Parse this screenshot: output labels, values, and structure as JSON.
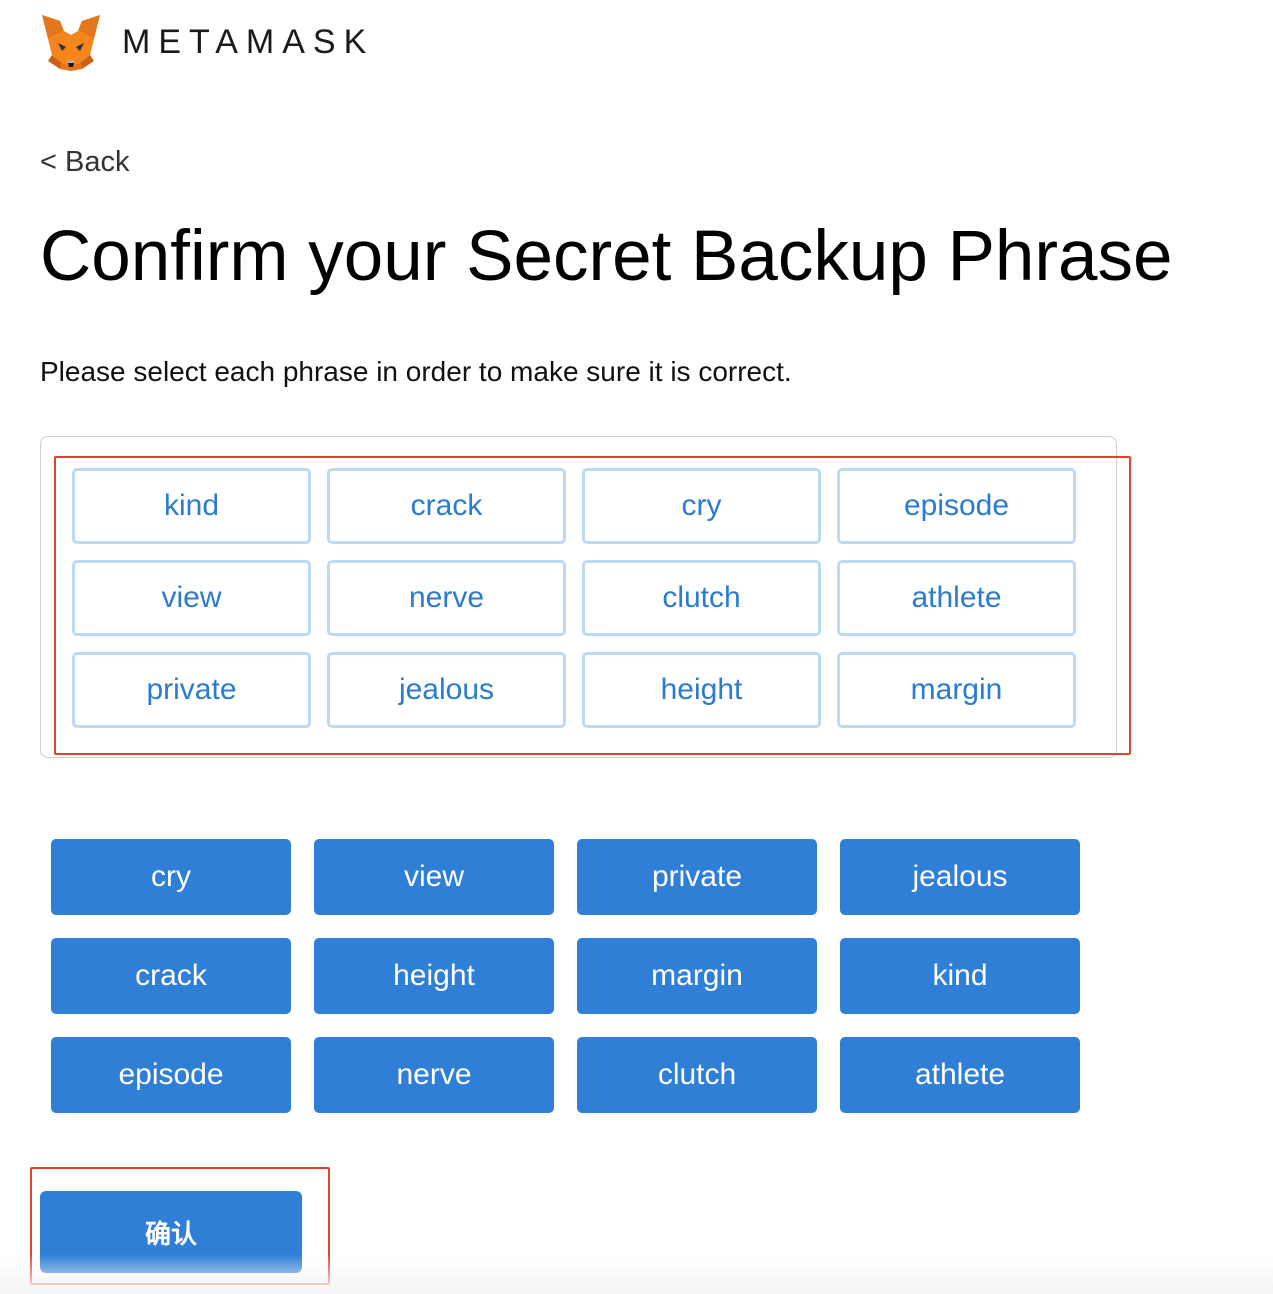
{
  "header": {
    "logo_icon": "metamask-fox-icon",
    "brand": "METAMASK"
  },
  "nav": {
    "back_label": "< Back"
  },
  "page": {
    "title": "Confirm your Secret Backup Phrase",
    "subtitle": "Please select each phrase in order to make sure it is correct."
  },
  "selected_words": [
    "kind",
    "crack",
    "cry",
    "episode",
    "view",
    "nerve",
    "clutch",
    "athlete",
    "private",
    "jealous",
    "height",
    "margin"
  ],
  "word_pool": [
    "cry",
    "view",
    "private",
    "jealous",
    "crack",
    "height",
    "margin",
    "kind",
    "episode",
    "nerve",
    "clutch",
    "athlete"
  ],
  "actions": {
    "confirm_label": "确认"
  },
  "colors": {
    "primary": "#2f7fd6",
    "chip_border": "#bcdaf3",
    "chip_text": "#2a7bd1",
    "highlight": "#e0452a"
  }
}
